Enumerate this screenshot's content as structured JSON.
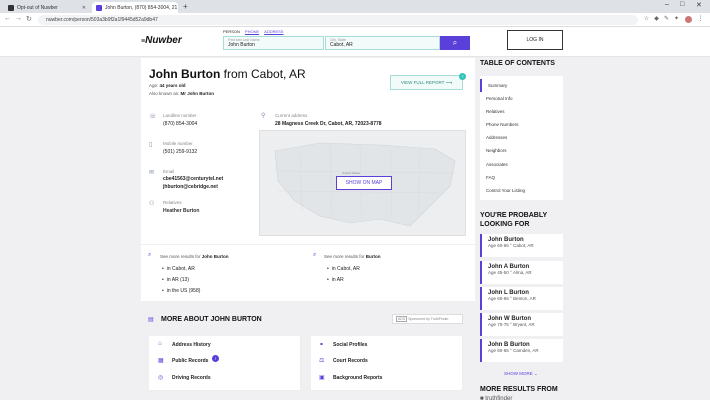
{
  "browser": {
    "tabs": [
      {
        "title": "Opt-out of Nuwber"
      },
      {
        "title": "John Burton, (870) 854-3004, 21"
      }
    ],
    "url": "nuwber.com/person/503a3b9f2a1f9445d52a9db47"
  },
  "header": {
    "logo": "Nuwber",
    "search_tabs": [
      "PERSON",
      "PHONE",
      "ADDRESS"
    ],
    "name_field": {
      "placeholder": "First and Last Name",
      "value": "John Burton"
    },
    "city_field": {
      "placeholder": "City, State",
      "value": "Cabot, AR"
    },
    "login_label": "LOG IN"
  },
  "person": {
    "name": "John Burton",
    "from": "from Cabot, AR",
    "age_label": "Age:",
    "age": "44 years old",
    "aka_label": "Also known as:",
    "aka": "Mr John Burton",
    "view_report": "VIEW FULL REPORT",
    "landline_label": "Landline number",
    "landline": "(870) 854-3004",
    "mobile_label": "Mobile number",
    "mobile": "(501) 259-9132",
    "email_label": "Email",
    "emails": [
      "cbe41563@centurytel.net",
      "jhburton@cebridge.net"
    ],
    "relatives_label": "Relatives",
    "relatives": "Heather Burton",
    "address_label": "Current address",
    "address": "28 Magness Creek Dr, Cabot, AR, 72023-8778",
    "map_note": "United States",
    "show_map": "SHOW ON MAP"
  },
  "more_results": [
    {
      "prefix": "See more results for",
      "name": "John Burton",
      "items": [
        "in Cabot, AR",
        "in AR (13)",
        "in the US (958)"
      ]
    },
    {
      "prefix": "See more results for",
      "name": "Burton",
      "items": [
        "in Cabot, AR",
        "in AR"
      ]
    }
  ],
  "more_about": {
    "title": "MORE ABOUT JOHN BURTON",
    "sponsor": "Sponsored by TruthFinder",
    "ad_label": "ADS",
    "left": [
      "Address History",
      "Public Records",
      "Driving Records"
    ],
    "right": [
      "Social Profiles",
      "Court Records",
      "Background Reports"
    ]
  },
  "sidebar": {
    "toc_title": "TABLE OF CONTENTS",
    "toc": [
      "Summary",
      "Personal Info",
      "Relatives",
      "Phone Numbers",
      "Addresses",
      "Neighbors",
      "Associates",
      "FAQ",
      "Control Your Listing"
    ],
    "looking_title": "YOU'RE PROBABLY LOOKING FOR",
    "people": [
      {
        "name": "John Burton",
        "detail": "Age 60-65 ° Cabot, AR"
      },
      {
        "name": "John A Burton",
        "detail": "Age 45-50 ° Alma, AR"
      },
      {
        "name": "John L Burton",
        "detail": "Age 60-65 ° Benton, AR"
      },
      {
        "name": "John W Burton",
        "detail": "Age 70-75 ° Bryant, AR"
      },
      {
        "name": "John B Burton",
        "detail": "Age 60-65 ° Camden, AR"
      }
    ],
    "show_more": "SHOW MORE",
    "more_from": "MORE RESULTS FROM",
    "more_from_brand": "truthfinder"
  }
}
